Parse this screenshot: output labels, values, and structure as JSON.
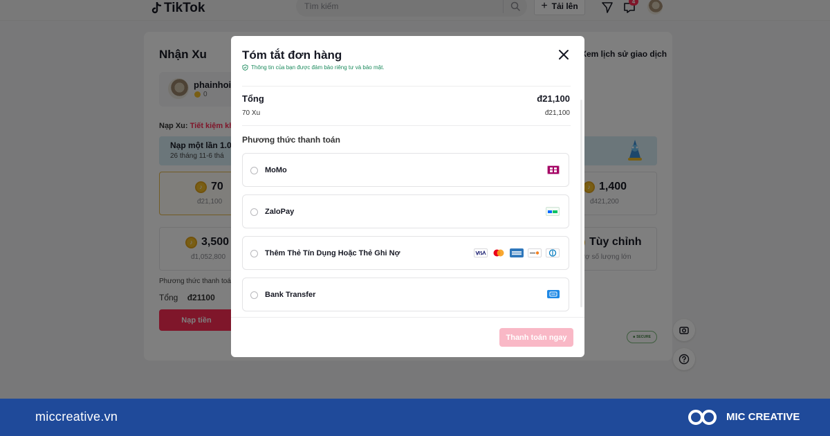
{
  "topbar": {
    "logo_text": "TikTok",
    "search_placeholder": "Tìm kiếm",
    "upload_label": "Tải lên",
    "inbox_badge": "4"
  },
  "background": {
    "title": "Nhận Xu",
    "history_link": "Xem lịch sử giao dịch",
    "username": "phainhoic",
    "coin_balance": "0",
    "recharge_label": "Nạp Xu:",
    "recharge_highlight": "Tiết kiệm kh",
    "banner_line1": "Nạp một lần 1.0",
    "banner_line2": "26 tháng 11-6 thá",
    "packages": [
      {
        "coins": "70",
        "price": "đ21,100"
      },
      {
        "coins": "1,400",
        "price": "đ421,200"
      },
      {
        "coins": "3,500",
        "price": "đ1,052,800"
      },
      {
        "coins": "Tùy chỉnh",
        "price": "trợ số lượng lớn"
      }
    ],
    "payment_method_label": "Phương thức thanh toán",
    "total_label": "Tổng",
    "total_value": "đ21100",
    "pay_button": "Nạp tiền",
    "secure_label": "SECURE"
  },
  "modal": {
    "title": "Tóm tắt đơn hàng",
    "privacy_note": "Thông tin của bạn được đảm bảo riêng tư và bảo mật.",
    "total_label": "Tổng",
    "total_value": "đ21,100",
    "item_label": "70 Xu",
    "item_price": "đ21,100",
    "payment_title": "Phương thức thanh toán",
    "options": [
      {
        "label": "MoMo"
      },
      {
        "label": "ZaloPay"
      },
      {
        "label": "Thêm Thẻ Tín Dụng Hoặc Thẻ Ghi Nợ"
      },
      {
        "label": "Bank Transfer"
      }
    ],
    "pay_now_label": "Thanh toán ngay"
  },
  "footer": {
    "site": "miccreative.vn",
    "brand": "MIC CREATIVE"
  }
}
